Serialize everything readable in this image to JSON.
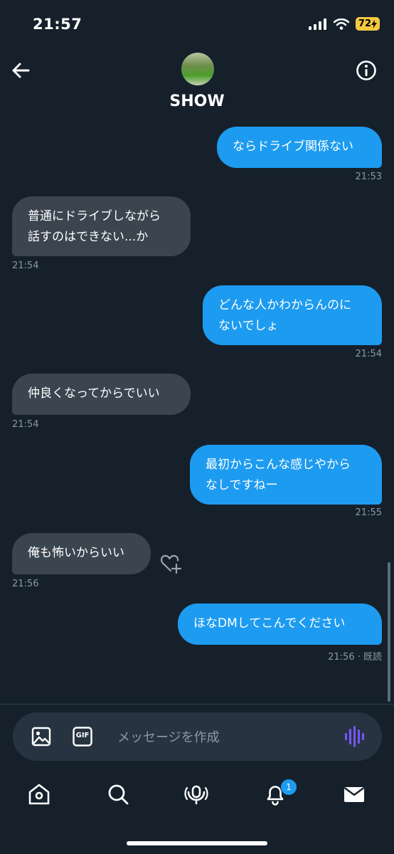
{
  "status_bar": {
    "time": "21:57",
    "battery": "72"
  },
  "header": {
    "name": "SHOW"
  },
  "messages": [
    {
      "side": "sent",
      "text": "ならドライブ関係ない",
      "time": "21:53"
    },
    {
      "side": "recv",
      "text": "普通にドライブしながら\n話すのはできない...か",
      "time": "21:54"
    },
    {
      "side": "sent",
      "text": "どんな人かわからんのに\nないでしょ",
      "time": "21:54"
    },
    {
      "side": "recv",
      "text": "仲良くなってからでいい",
      "time": "21:54"
    },
    {
      "side": "sent",
      "text": "最初からこんな感じやから\nなしですねー",
      "time": "21:55"
    },
    {
      "side": "recv",
      "text": "俺も怖いからいい",
      "time": "21:56"
    },
    {
      "side": "sent",
      "text": "ほなDMしてこんでください",
      "time": "21:56 · 既読"
    }
  ],
  "composer": {
    "placeholder": "メッセージを作成",
    "gif_label": "GIF"
  },
  "bottom_nav": {
    "notification_badge": "1"
  },
  "colors": {
    "background": "#15202b",
    "sent_bubble": "#1d9bf0",
    "received_bubble": "#3a4550",
    "voice_accent": "#7856ff"
  },
  "icons": [
    "back-arrow-icon",
    "info-icon",
    "heart-add-icon",
    "image-icon",
    "gif-icon",
    "voice-icon",
    "home-icon",
    "search-icon",
    "spaces-icon",
    "bell-icon",
    "mail-icon"
  ]
}
